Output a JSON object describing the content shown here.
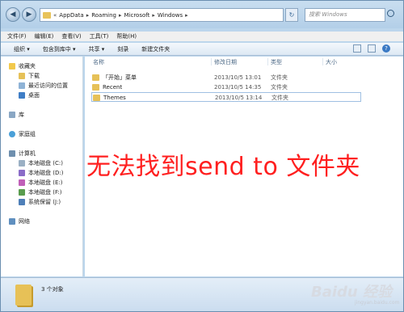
{
  "address": {
    "crumbs": [
      "AppData",
      "Roaming",
      "Microsoft",
      "Windows"
    ],
    "lead": "«",
    "sep": "▸"
  },
  "search": {
    "placeholder": "搜索 Windows"
  },
  "menu": [
    "文件(F)",
    "编辑(E)",
    "查看(V)",
    "工具(T)",
    "帮助(H)"
  ],
  "toolbar": [
    "组织 ▾",
    "包含到库中 ▾",
    "共享 ▾",
    "刻录",
    "新建文件夹"
  ],
  "nav": {
    "favorites": {
      "title": "收藏夹",
      "items": [
        "下载",
        "最近访问的位置",
        "桌面"
      ]
    },
    "library": "库",
    "homegroup": "家庭组",
    "computer": {
      "title": "计算机",
      "items": [
        "本地磁盘 (C:)",
        "本地磁盘 (D:)",
        "本地磁盘 (E:)",
        "本地磁盘 (F:)",
        "系统保留 (J:)"
      ]
    },
    "network": "网络"
  },
  "columns": [
    "名称",
    "修改日期",
    "类型",
    "大小"
  ],
  "files": [
    {
      "name": "「开始」菜单",
      "date": "2013/10/5 13:01",
      "type": "文件夹"
    },
    {
      "name": "Recent",
      "date": "2013/10/5 14:35",
      "type": "文件夹"
    },
    {
      "name": "Themes",
      "date": "2013/10/5 13:14",
      "type": "文件夹"
    }
  ],
  "overlay_text": "无法找到send to 文件夹",
  "status": {
    "count": "3 个对象"
  },
  "watermark": {
    "main": "Baidu 经验",
    "sub": "jingyan.baidu.com"
  },
  "colors": {
    "overlay": "#ff1f1f",
    "folder": "#e6c158",
    "accent": "#3a79c4"
  }
}
